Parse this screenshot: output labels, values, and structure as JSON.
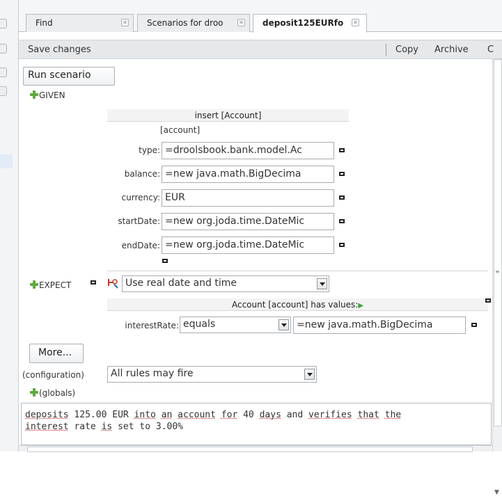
{
  "tabs": [
    {
      "label": "Find"
    },
    {
      "label": "Scenarios for droo"
    },
    {
      "label": "deposit125EURfo"
    }
  ],
  "toolbar": {
    "save_label": "Save changes",
    "copy_label": "Copy",
    "archive_label": "Archive",
    "overflow_label": "C"
  },
  "run_label": "Run scenario",
  "given": {
    "label": "GIVEN",
    "fact_header": "insert [Account]",
    "fact_var": "[account]",
    "fields": [
      {
        "label": "type:",
        "value": "=droolsbook.bank.model.Ac"
      },
      {
        "label": "balance:",
        "value": "=new java.math.BigDecima"
      },
      {
        "label": "currency:",
        "value": "EUR"
      },
      {
        "label": "startDate:",
        "value": "=new org.joda.time.DateMic"
      },
      {
        "label": "endDate:",
        "value": "=new org.joda.time.DateMic"
      }
    ]
  },
  "expect": {
    "label": "EXPECT",
    "date_mode": "Use real date and time",
    "header": "Account [account] has values:",
    "row": {
      "field": "interestRate:",
      "operator": "equals",
      "value": "=new java.math.BigDecima"
    }
  },
  "more_label": "More...",
  "config": {
    "label": "(configuration)",
    "value": "All rules may fire"
  },
  "globals_label": "(globals)",
  "description": {
    "line1": [
      "deposits",
      " 125.00 EUR ",
      "into",
      " ",
      "an",
      " ",
      "account",
      " ",
      "for",
      " 40 ",
      "days",
      " and ",
      "verifies",
      " ",
      "that",
      " ",
      "the"
    ],
    "line2": [
      "interest",
      " rate ",
      "is",
      " set to 3.00%"
    ]
  },
  "colors": {
    "plus_icon": "#5eaa3a",
    "play_icon": "#3aa33a",
    "active_tab": "#ffffff"
  }
}
